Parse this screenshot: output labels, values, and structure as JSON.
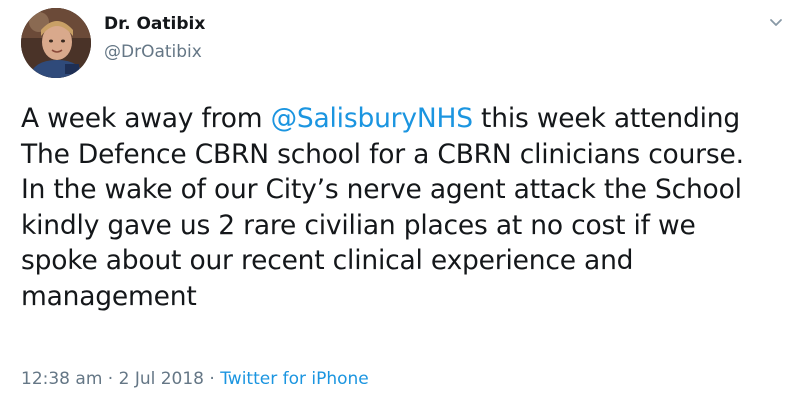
{
  "author": {
    "display_name": "Dr. Oatibix",
    "handle": "@DrOatibix"
  },
  "tweet": {
    "lines": [
      {
        "before": "A week away from ",
        "mention": "@SalisburyNHS",
        "after": " this week attending"
      },
      {
        "text": "The Defence CBRN school for a CBRN clinicians course."
      },
      {
        "text": "In the wake of our City’s nerve agent attack the School"
      },
      {
        "text": "kindly gave us 2 rare civilian places at no cost if we"
      },
      {
        "text": "spoke about our recent clinical experience and"
      },
      {
        "text": "management"
      }
    ]
  },
  "meta": {
    "time": "12:38 am",
    "separator": " · ",
    "date": "2 Jul 2018",
    "separator2": " · ",
    "source": "Twitter for iPhone"
  },
  "icons": {
    "menu": "chevron-down-icon",
    "avatar": "profile-photo"
  },
  "colors": {
    "link": "#1b95e0",
    "secondary_text": "#657786",
    "primary_text": "#14171a"
  }
}
